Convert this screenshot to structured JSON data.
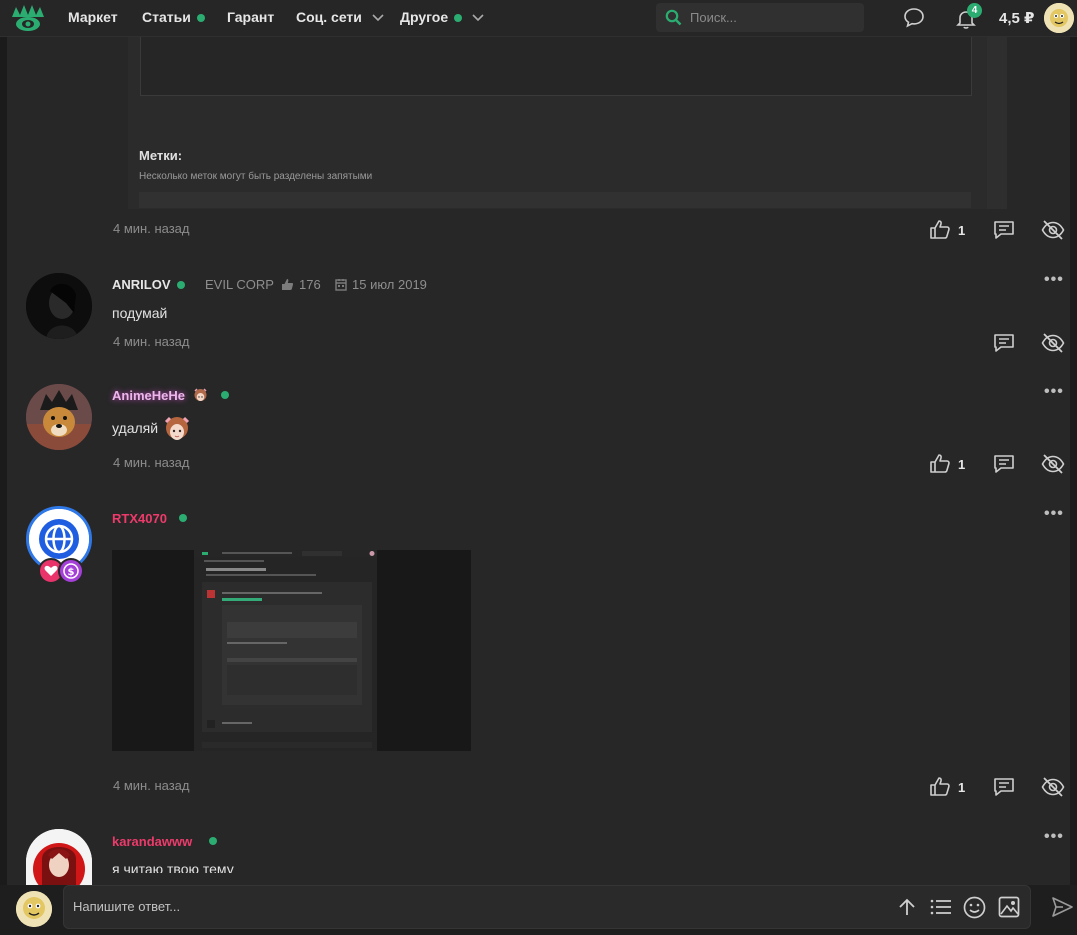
{
  "nav": {
    "market": "Маркет",
    "articles": "Статьи",
    "guarantor": "Гарант",
    "social": "Соц. сети",
    "other": "Другое",
    "search_placeholder": "Поиск...",
    "notifications_count": "4",
    "balance": "4,5 ₽"
  },
  "post_editor": {
    "tags_label": "Метки:",
    "tags_hint": "Несколько меток могут быть разделены запятыми"
  },
  "first_time": "4 мин. назад",
  "first_likes": "1",
  "comments": [
    {
      "author": "ANRILOV",
      "author_color": "#e6e6e6",
      "group": "EVIL CORP",
      "likes_total": "176",
      "registered": "15 июл 2019",
      "text": "подумай",
      "time": "4 мин. назад"
    },
    {
      "author": "AnimeHeHe",
      "author_color": "#e9a3e6",
      "text": "удаляй",
      "time": "4 мин. назад",
      "likes": "1"
    },
    {
      "author": "RTX4070",
      "author_color": "#ee3a6b",
      "time": "4 мин. назад",
      "likes": "1"
    },
    {
      "author": "karandawww",
      "author_color": "#ee3a6b",
      "text": "я читаю твою тему"
    }
  ],
  "reply": {
    "placeholder": "Напишите ответ..."
  },
  "colors": {
    "accent": "#2bad72",
    "background": "#272727"
  }
}
